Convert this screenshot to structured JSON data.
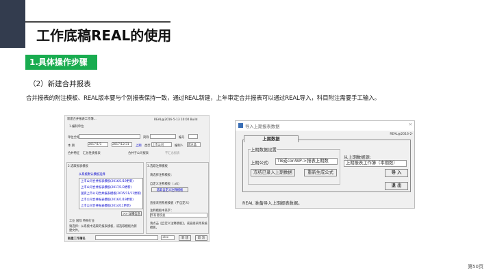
{
  "header": {
    "title": "工作底稿REAL的使用",
    "section_badge": "1.具体操作步骤",
    "subtitle": "（2）新建合并报表",
    "description": "合并报表的附注模板、REAL版本要与个别报表保持一致，通过REAL新建，上年审定合并报表可以通过REAL导入，科目附注需要手工输入。"
  },
  "left_dialog": {
    "title": "新建合并报表工作簿...",
    "version": "REAL@2016-5-13 10:00 Build",
    "tab1": "1.编制单位",
    "unit_label": "单位全称",
    "short_label": "简称",
    "code_label": "编号",
    "period_label": "本 期",
    "date_from": "2017/1/1",
    "date_to": "2017/12/31",
    "prev_button": "上期",
    "type_label": "类型",
    "type_value": "上市公司",
    "preparer_label": "编制人",
    "preparer_value": "周冰晶",
    "merge_label": "合并特征",
    "radio1": "汇总性质报表",
    "radio2": "合并子公司报表",
    "radio3": "不汇总报表",
    "tab2": "2.选取报表模板",
    "tab3": "3.选取注释模板",
    "from_default": "从系统默认模板选择",
    "templates": [
      "上市公司合并报表模板(2016/1/19更新)",
      "上市公司合并报表模板(2017/1/3更新)",
      "国资上市公司合并报表模板(2015/11/11更新)",
      "上市公司合并报表模板(2016/1/19更新)",
      "上市公司合并报表模板(2014/11更新)"
    ],
    "detail_button": ">> 详细信息",
    "industry_check": "工业 国际 特殊行业",
    "hint_left": "请选择：从系统中选取的报表模板，或选取模板为新建文件。",
    "note_title": "请选择注释模板：",
    "custom_note": "自定义注释模板（.xlt）",
    "choose_note_button": "选取自定义注释模板",
    "use_recommended": "直接采用系统模板（不自定义）",
    "note_version_label": "注释模板中英字：",
    "note_version_value": "所有者权益",
    "hint_right": "请点击【自定义注释模板】，或直接采用系统模板。",
    "filename_label": "新建工作簿名",
    "ext": ".xlsx",
    "new_button": "新 建",
    "cancel_button": "取 消"
  },
  "right_dialog": {
    "title": "导入上期报表数据",
    "version": "REAL@2016-2-",
    "tab": "上期数据",
    "group": "上期数据设置",
    "formula_label": "上期公式:",
    "formula_value": "TB或conWP->报表上期数",
    "source_label": "从上期数据源:",
    "source_value": "上期报表工作簿（本期数）",
    "import_button": "导 入",
    "exit_button": "退 出",
    "clear_button": "冻结已录入上期数据",
    "regen_button": "重新生成公式",
    "status": "REAL 准备导入上期报表数据。"
  },
  "footer": {
    "page": "第50页"
  }
}
